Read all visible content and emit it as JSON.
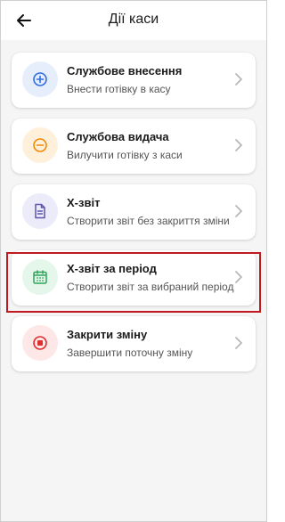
{
  "header": {
    "title": "Дії каси"
  },
  "colors": {
    "blue_bg": "#e6eefc",
    "blue_fg": "#2f6de1",
    "orange_bg": "#fff0dc",
    "orange_fg": "#f08a00",
    "purple_bg": "#ecebfa",
    "purple_fg": "#5b56a8",
    "green_bg": "#e5f6ea",
    "green_fg": "#2ea55a",
    "red_bg": "#fde7e7",
    "red_fg": "#e02d2d",
    "highlight": "#c0191f"
  },
  "actions": [
    {
      "title": "Службове внесення",
      "subtitle": "Внести готівку в касу",
      "icon": "plus-circle-icon"
    },
    {
      "title": "Службова видача",
      "subtitle": "Вилучити готівку з каси",
      "icon": "minus-circle-icon"
    },
    {
      "title": "X-звіт",
      "subtitle": "Створити звіт без закриття зміни",
      "icon": "document-icon"
    },
    {
      "title": "X-звіт за період",
      "subtitle": "Створити звіт за вибраний період",
      "icon": "calendar-icon"
    },
    {
      "title": "Закрити зміну",
      "subtitle": "Завершити поточну зміну",
      "icon": "stop-icon"
    }
  ]
}
